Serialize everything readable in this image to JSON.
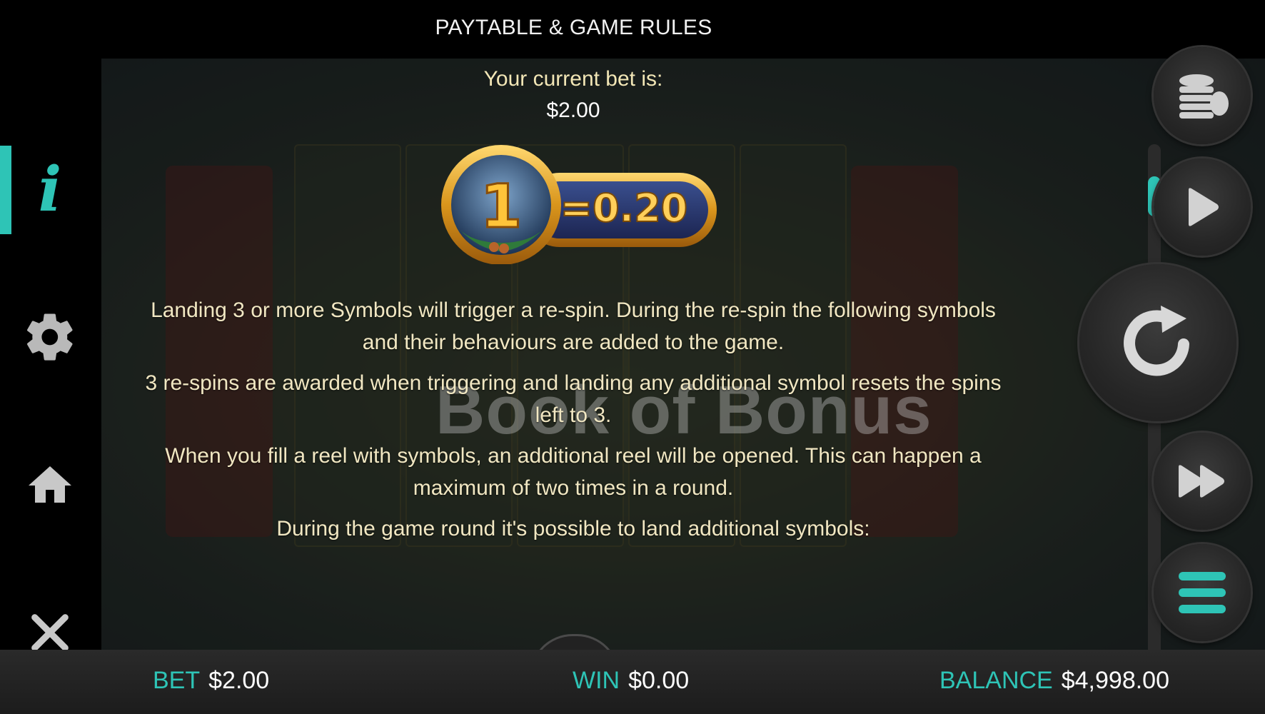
{
  "header": {
    "title": "PAYTABLE & GAME RULES"
  },
  "nav": {
    "items": [
      {
        "name": "info",
        "icon": "info-icon",
        "active": true
      },
      {
        "name": "settings",
        "icon": "gear-icon",
        "active": false
      },
      {
        "name": "home",
        "icon": "home-icon",
        "active": false
      },
      {
        "name": "close",
        "icon": "close-icon",
        "active": false
      }
    ],
    "info_glyph": "i"
  },
  "paytable": {
    "bet_label": "Your current bet is:",
    "bet_value": "$2.00",
    "coin_number": "1",
    "coin_value": "=0.20"
  },
  "rules": [
    "Landing 3 or more Symbols will trigger a re-spin. During the re-spin the following symbols and their behaviours are added to the game.",
    "3 re-spins are awarded when triggering and landing any additional symbol resets the spins left to 3.",
    "When you fill a reel with symbols, an additional reel will be opened. This can happen a maximum of two times in a round.",
    "During the game round it's possible to land additional symbols:"
  ],
  "watermark": "Book of Bonus",
  "controls": [
    "coins-icon",
    "play-icon",
    "spin-icon",
    "fast-forward-icon",
    "menu-icon"
  ],
  "footer": {
    "bet_label": "BET",
    "bet_value": "$2.00",
    "win_label": "WIN",
    "win_value": "$0.00",
    "balance_label": "BALANCE",
    "balance_value": "$4,998.00"
  },
  "colors": {
    "accent": "#2ec4b6",
    "rule_text": "#f1e7c2",
    "gold": "#e0a82a"
  }
}
